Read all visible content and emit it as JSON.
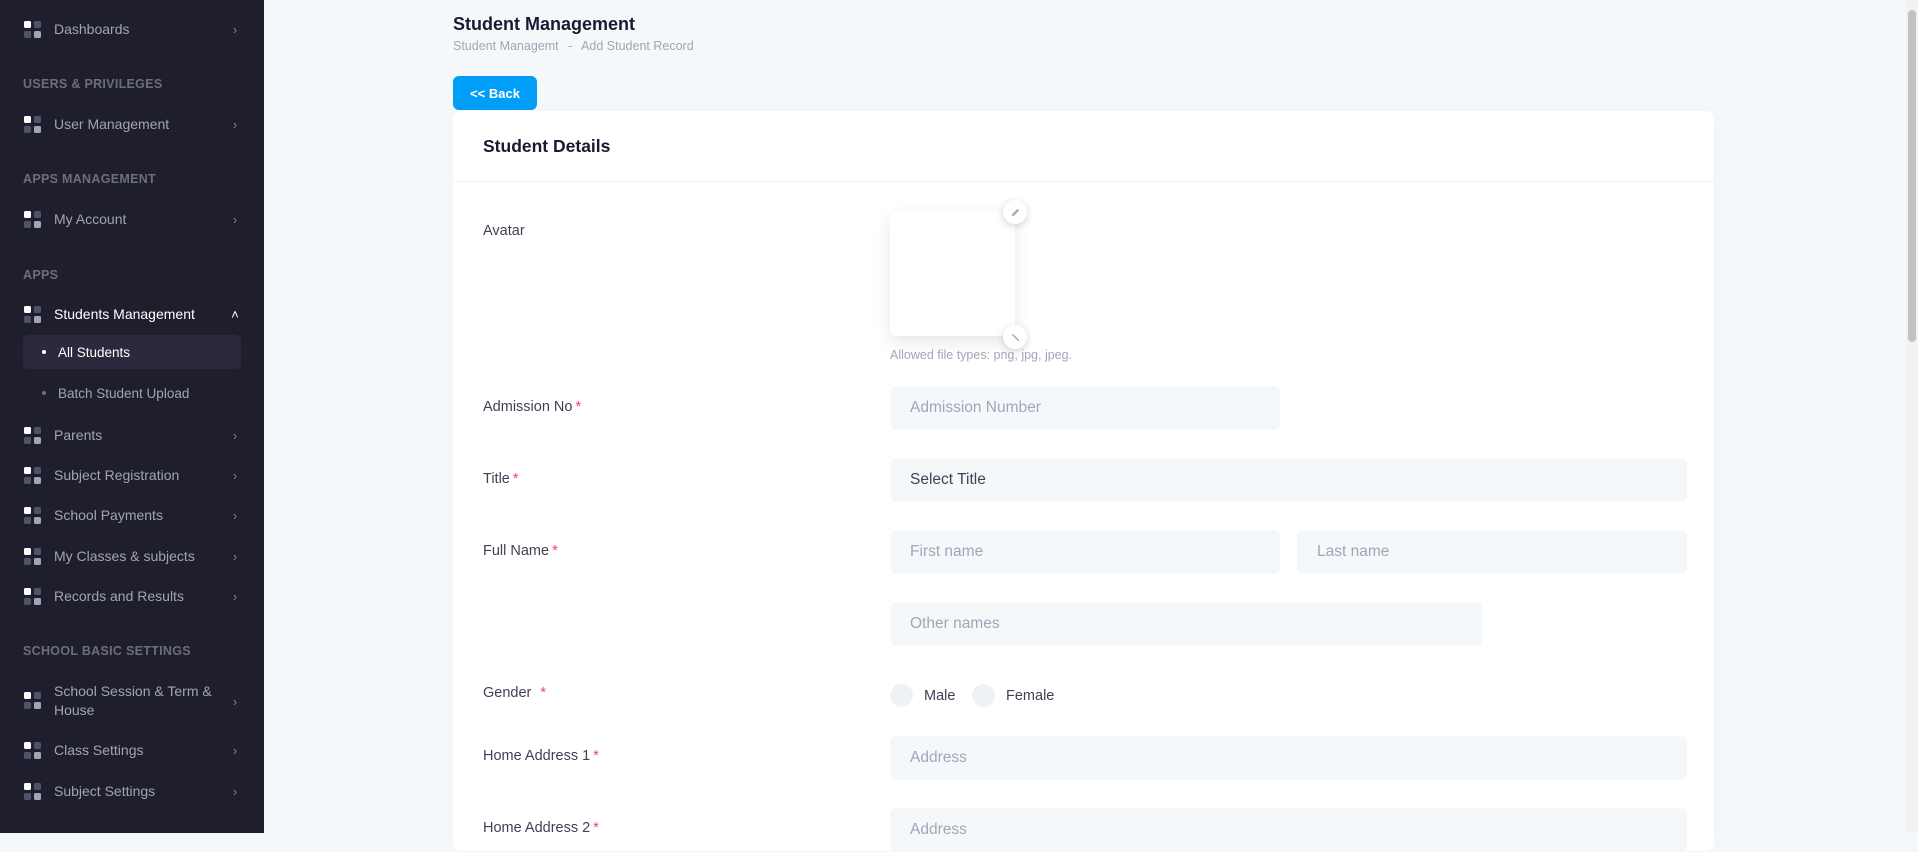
{
  "sidebar": {
    "items": [
      {
        "label": "Dashboards"
      },
      {
        "section": "USERS & PRIVILEGES"
      },
      {
        "label": "User Management"
      },
      {
        "section": "APPS MANAGEMENT"
      },
      {
        "label": "My Account"
      },
      {
        "section": "APPS"
      },
      {
        "label": "Students Management",
        "expanded": true
      },
      {
        "label": "Parents"
      },
      {
        "label": "Subject Registration"
      },
      {
        "label": "School Payments"
      },
      {
        "label": "My Classes & subjects"
      },
      {
        "label": "Records and Results"
      },
      {
        "section": "SCHOOL BASIC SETTINGS"
      },
      {
        "label": "School Session & Term & House"
      },
      {
        "label": "Class Settings"
      },
      {
        "label": "Subject Settings"
      }
    ],
    "sub_items": [
      {
        "label": "All Students",
        "active": true
      },
      {
        "label": "Batch Student Upload"
      }
    ]
  },
  "header": {
    "title": "Student Management",
    "breadcrumb": [
      "Student Managemt",
      "-",
      "Add Student Record"
    ]
  },
  "back_button": "<< Back",
  "card": {
    "title": "Student Details",
    "avatar_label": "Avatar",
    "avatar_hint": "Allowed file types: png, jpg, jpeg.",
    "required_mark": "*",
    "admission_label": "Admission No",
    "admission_placeholder": "Admission Number",
    "title_label": "Title",
    "title_select": "Select Title",
    "fullname_label": "Full Name",
    "first_placeholder": "First name",
    "last_placeholder": "Last name",
    "other_placeholder": "Other names",
    "gender_label": "Gender",
    "gender_options": [
      "Male",
      "Female"
    ],
    "address1_label": "Home Address 1",
    "address2_label": "Home Address 2",
    "address_placeholder": "Address"
  },
  "colors": {
    "sidebar_bg": "#1e1e2d",
    "primary": "#009ef7",
    "required": "#f1416c",
    "page_bg": "#f5f8fa"
  },
  "icons": [
    "grid-icon",
    "chevron-right-icon",
    "chevron-up-icon",
    "pencil-icon",
    "remove-icon"
  ]
}
